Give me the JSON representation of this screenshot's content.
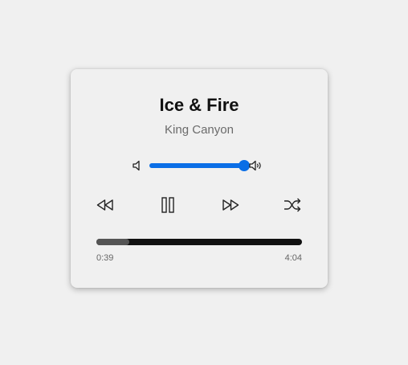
{
  "track": {
    "title": "Ice & Fire",
    "artist": "King Canyon"
  },
  "volume": {
    "level_percent": 100,
    "min_icon": "volume-low-icon",
    "max_icon": "volume-high-icon"
  },
  "controls": {
    "rewind_icon": "rewind-icon",
    "pause_icon": "pause-icon",
    "fast_forward_icon": "fast-forward-icon",
    "shuffle_icon": "shuffle-icon"
  },
  "progress": {
    "current_time": "0:39",
    "total_time": "4:04",
    "fraction": 0.16
  },
  "colors": {
    "accent": "#0a6ee6",
    "text": "#111111",
    "muted": "#6b6b6b",
    "progress_track": "#111111",
    "progress_fill": "#555555"
  }
}
